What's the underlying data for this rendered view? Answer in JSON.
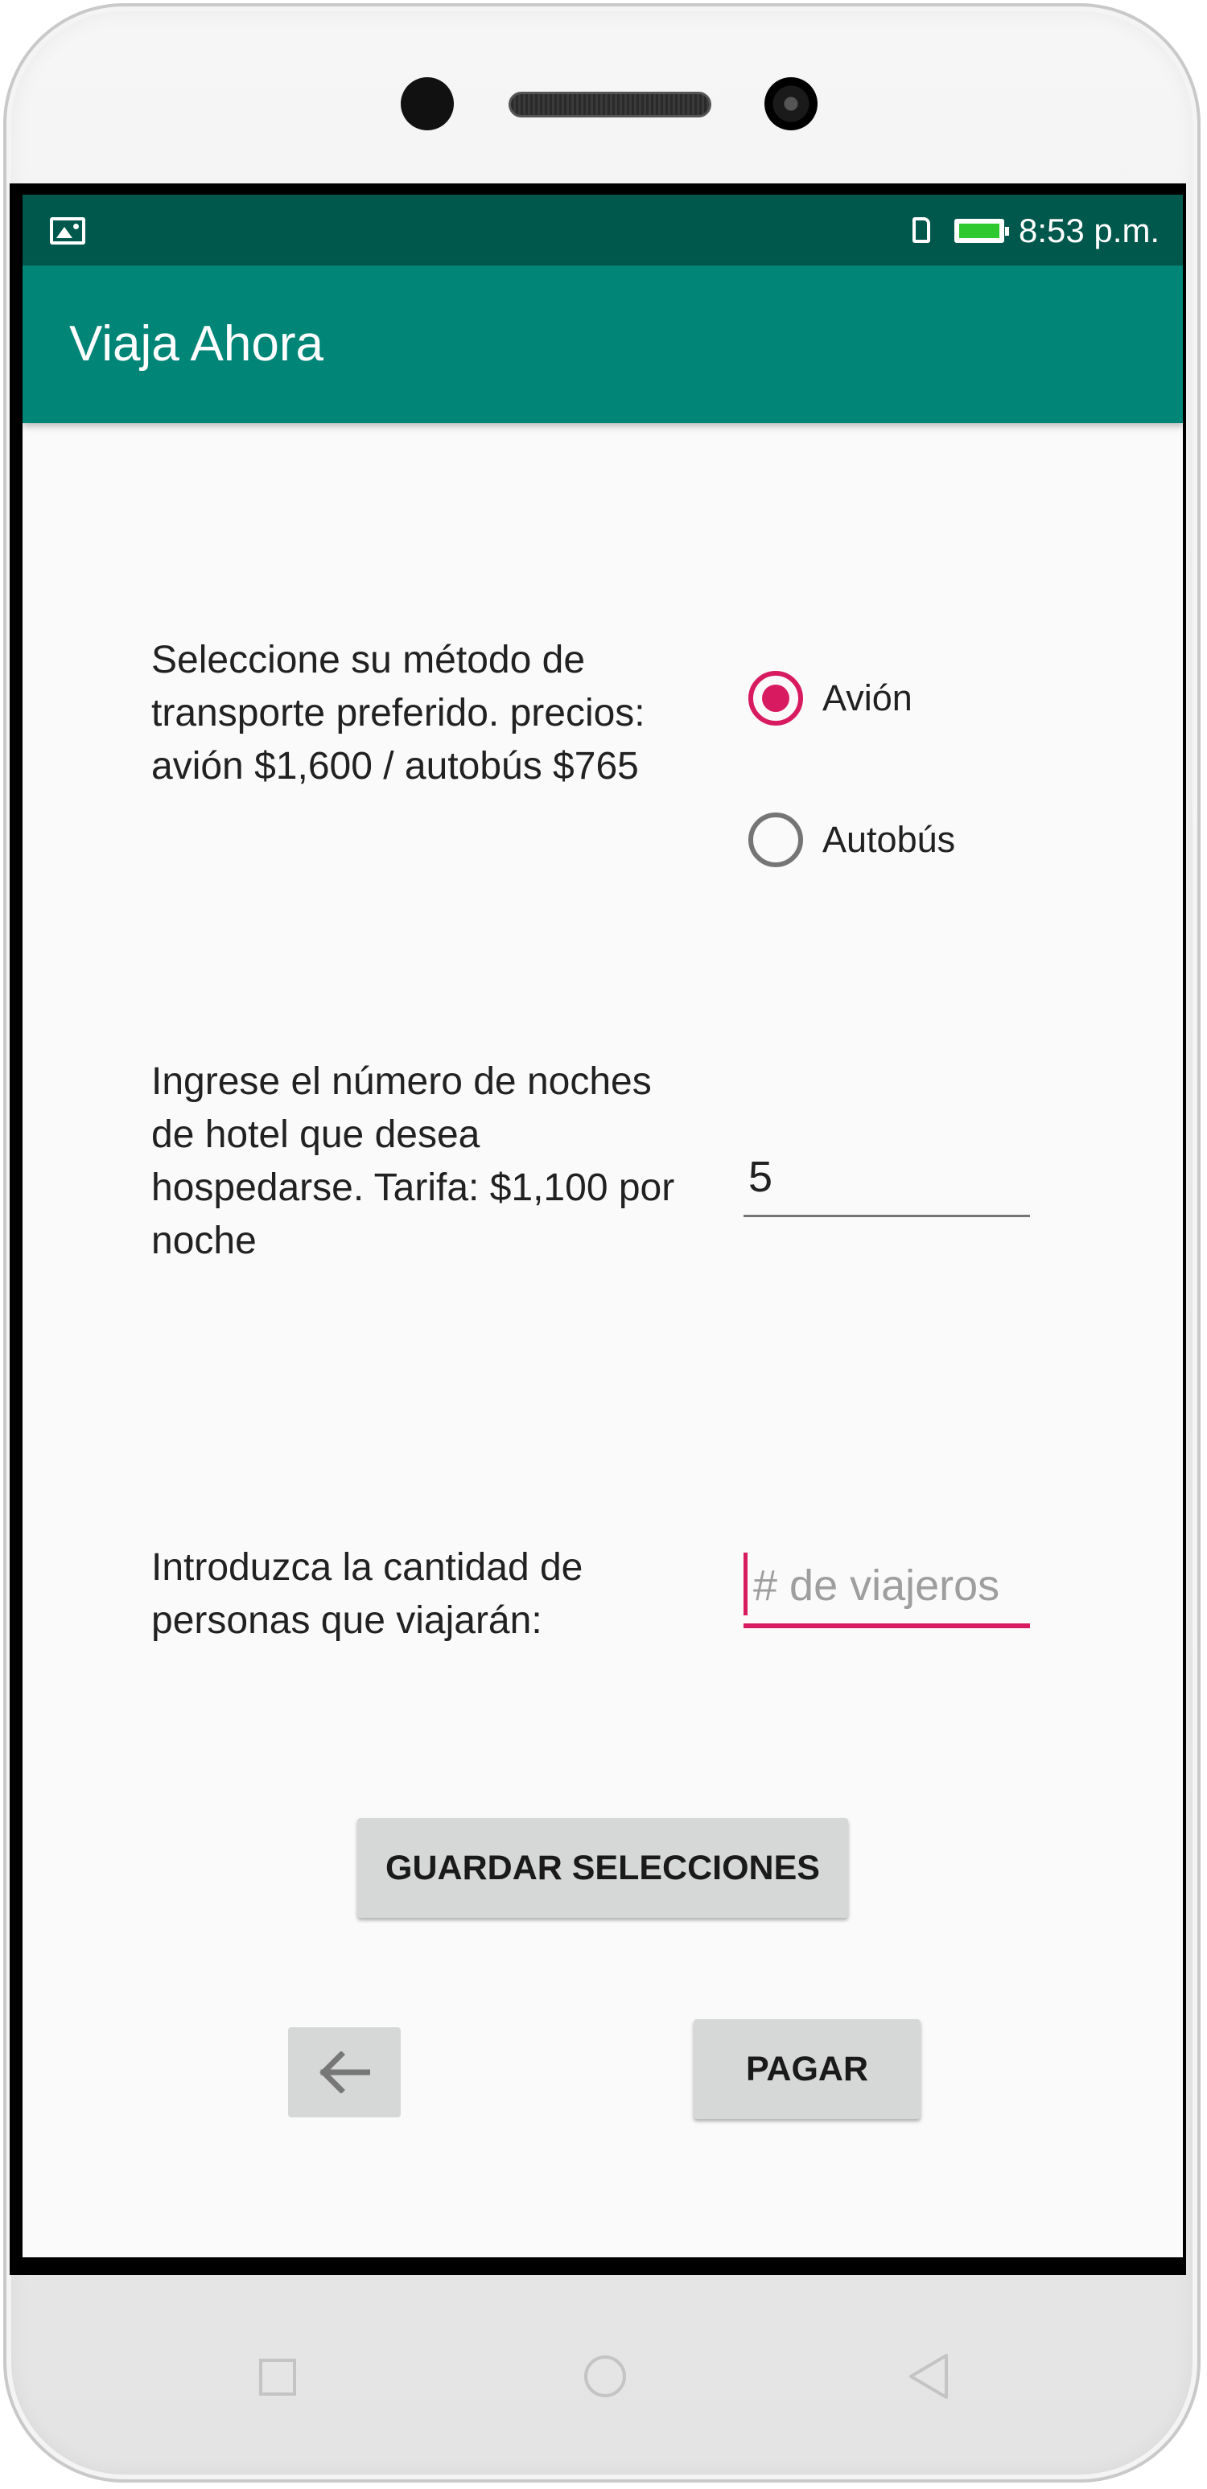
{
  "status_bar": {
    "time": "8:53 p.m.",
    "icons": [
      "image-icon",
      "sim-card-icon",
      "battery-icon"
    ],
    "battery_color": "#2ec92e"
  },
  "app_bar": {
    "title": "Viaja Ahora",
    "color": "#008577"
  },
  "transport": {
    "prompt": "Seleccione su método de transporte preferido. precios: avión $1,600 / autobús $765",
    "options": [
      {
        "label": "Avión",
        "checked": true
      },
      {
        "label": "Autobús",
        "checked": false
      }
    ]
  },
  "hotel": {
    "prompt": "Ingrese el número de noches de hotel que desea hospedarse. Tarifa: $1,100 por noche",
    "value": "5"
  },
  "travelers": {
    "prompt": "Introduzca la cantidad de personas que viajarán:",
    "value": "",
    "placeholder": "# de viajeros"
  },
  "buttons": {
    "save_label": "GUARDAR SELECCIONES",
    "back_icon": "arrow-left-icon",
    "pay_label": "PAGAR"
  },
  "accent_color": "#d81b60",
  "nav_bar": {
    "icons": [
      "square-icon",
      "circle-icon",
      "triangle-back-icon"
    ]
  }
}
